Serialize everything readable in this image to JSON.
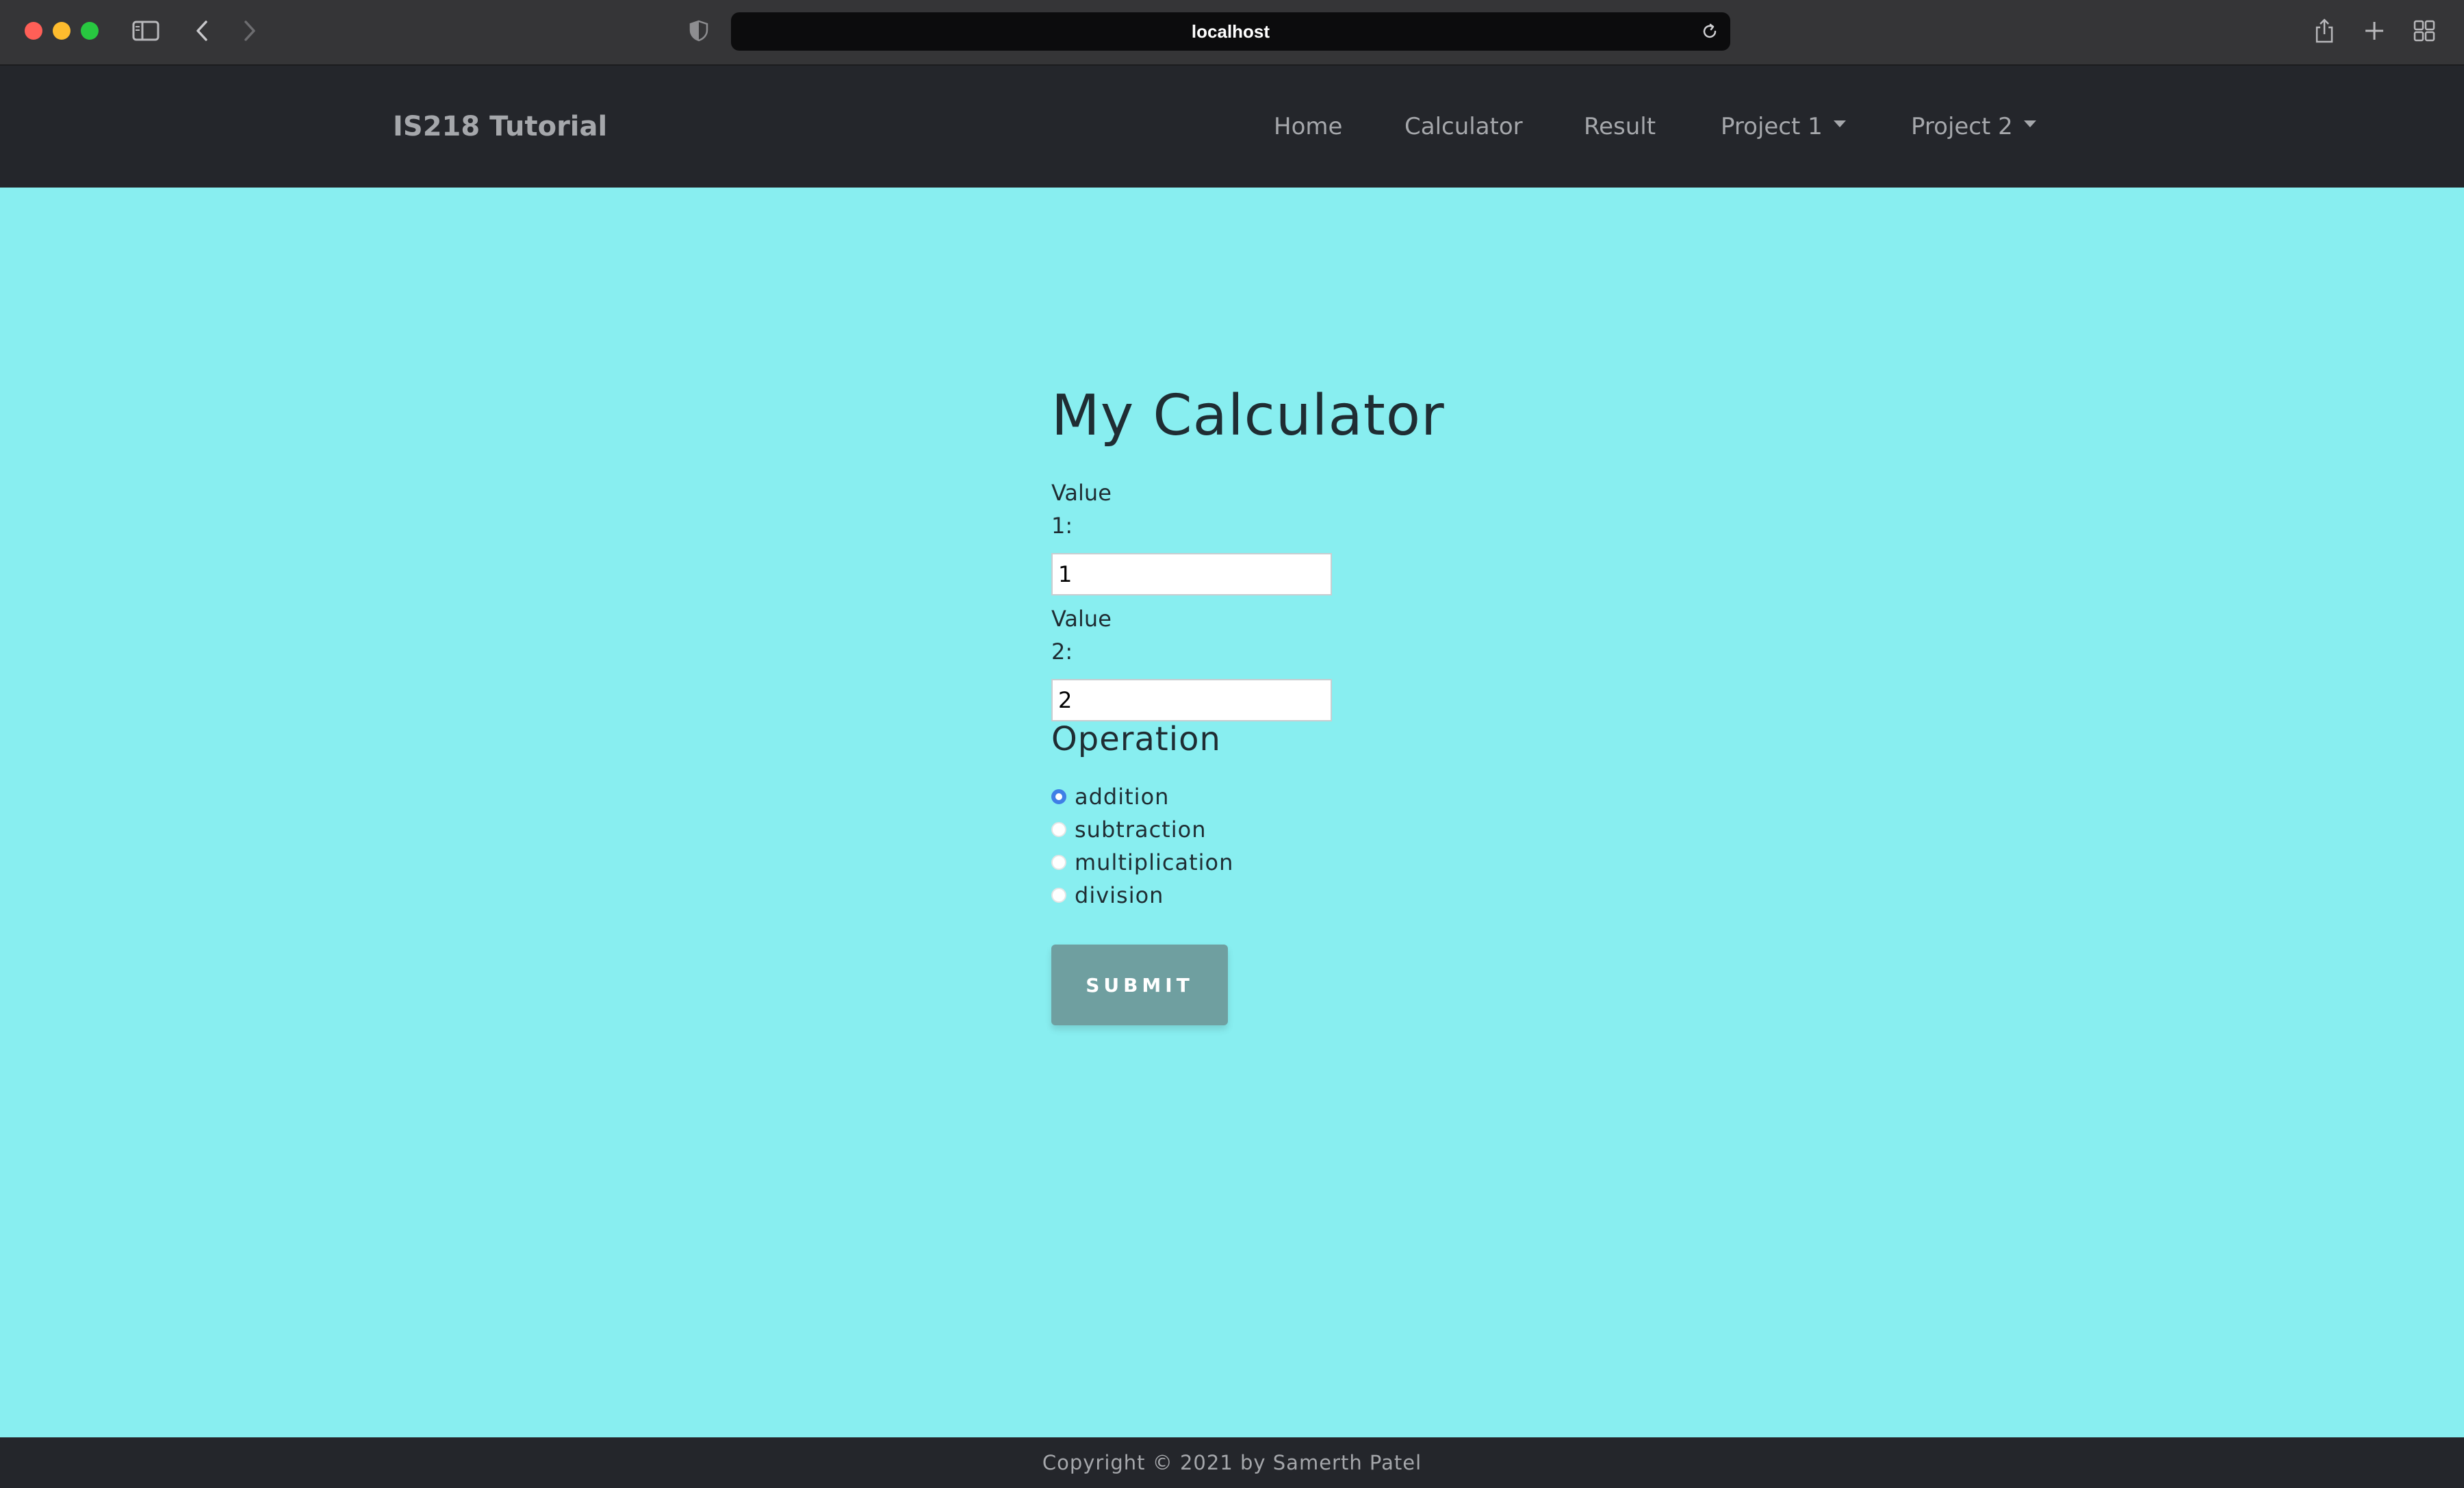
{
  "browser": {
    "url": "localhost",
    "icons": [
      "sidebar-icon",
      "back-icon",
      "forward-icon",
      "privacy-shield-icon",
      "reload-icon",
      "share-icon",
      "new-tab-icon",
      "tab-overview-icon"
    ]
  },
  "navbar": {
    "brand": "IS218 Tutorial",
    "items": [
      {
        "label": "Home"
      },
      {
        "label": "Calculator"
      },
      {
        "label": "Result"
      },
      {
        "label": "Project 1",
        "dropdown": true
      },
      {
        "label": "Project 2",
        "dropdown": true
      }
    ]
  },
  "calculator": {
    "title": "My Calculator",
    "value1": {
      "label": "Value 1:",
      "value": "1"
    },
    "value2": {
      "label": "Value 2:",
      "value": "2"
    },
    "operation_heading": "Operation",
    "operations": [
      {
        "label": "addition",
        "checked": true
      },
      {
        "label": "subtraction",
        "checked": false
      },
      {
        "label": "multiplication",
        "checked": false
      },
      {
        "label": "division",
        "checked": false
      }
    ],
    "submit_label": "SUBMIT"
  },
  "footer": {
    "text": "Copyright © 2021 by Samerth Patel"
  },
  "colors": {
    "page_background": "#88eef0",
    "navbar_background": "#24262b",
    "submit_button": "#6f9fa0",
    "radio_selected": "#3f7fe6"
  }
}
